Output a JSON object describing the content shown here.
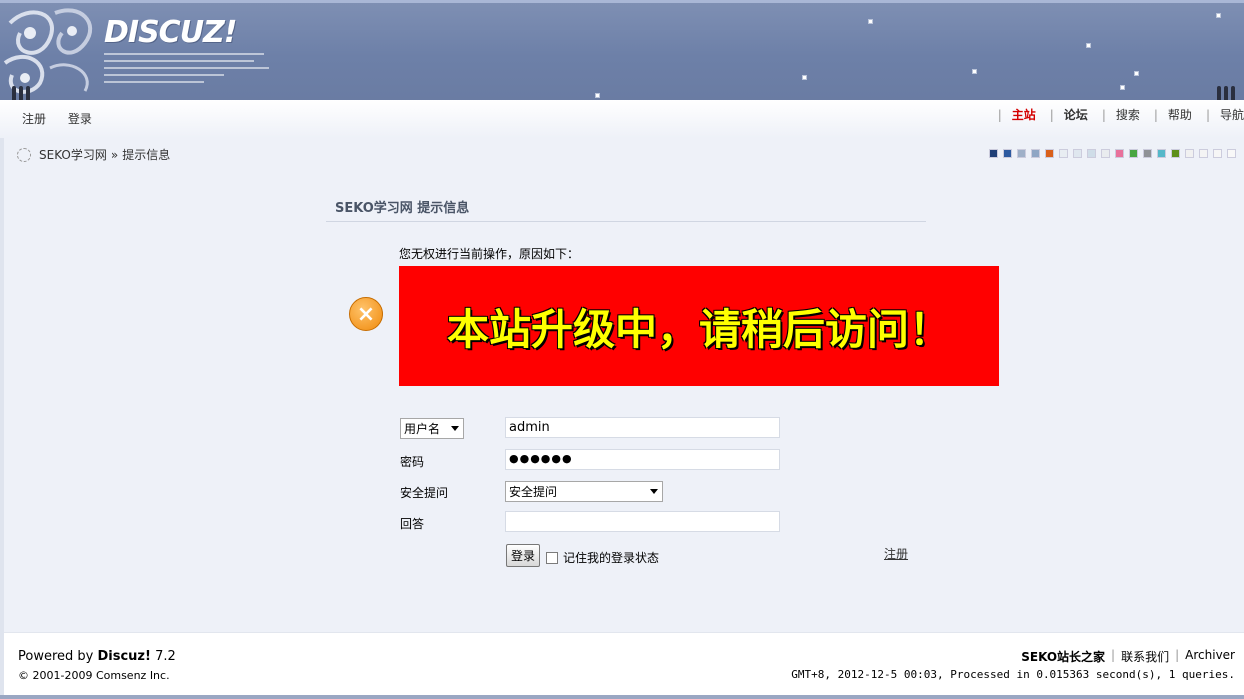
{
  "header": {
    "logo_text": "DISCUZ!",
    "logo_ornament": "floral-ornament-icon"
  },
  "nav": {
    "left": [
      "注册",
      "登录"
    ],
    "right": [
      {
        "label": "主站",
        "active": true
      },
      {
        "label": "论坛",
        "bold": true
      },
      {
        "label": "搜索"
      },
      {
        "label": "帮助"
      },
      {
        "label": "导航"
      }
    ]
  },
  "breadcrumb": {
    "site": "SEKO学习网",
    "separator": "»",
    "current": "提示信息"
  },
  "style_swatches": [
    "#1f3f77",
    "#2d5aa0",
    "#9fb0c8",
    "#8fa6c4",
    "#d9601b",
    "#e8edf2",
    "#dfe7ef",
    "#cfdde8",
    "#e9ecef",
    "#e8719b",
    "#48a641",
    "#8f9296",
    "#55b8c9",
    "#5d8f1a",
    "#f1f1f1",
    "#f4f4f4",
    "#f6f6f6",
    "#f8f8f8"
  ],
  "message": {
    "title": "SEKO学习网  提示信息",
    "reason": "您无权进行当前操作，原因如下：",
    "notice": "本站升级中，请稍后访问！",
    "icon": "error-x-icon"
  },
  "login": {
    "username_select": "用户名",
    "username_value": "admin",
    "password_label": "密码",
    "password_value": "●●●●●●",
    "question_label": "安全提问",
    "question_select": "安全提问",
    "answer_label": "回答",
    "answer_value": "",
    "login_button": "登录",
    "remember_label": "记住我的登录状态",
    "register_link": "注册"
  },
  "footer": {
    "powered_prefix": "Powered by ",
    "powered_brand": "Discuz!",
    "powered_version": " 7.2",
    "copyright": "© 2001-2009 Comsenz Inc.",
    "links": [
      {
        "label": "SEKO站长之家",
        "bold": true
      },
      {
        "label": "联系我们"
      },
      {
        "label": "Archiver"
      }
    ],
    "timing": "GMT+8, 2012-12-5 00:03, Processed in 0.015363 second(s), 1 queries."
  }
}
